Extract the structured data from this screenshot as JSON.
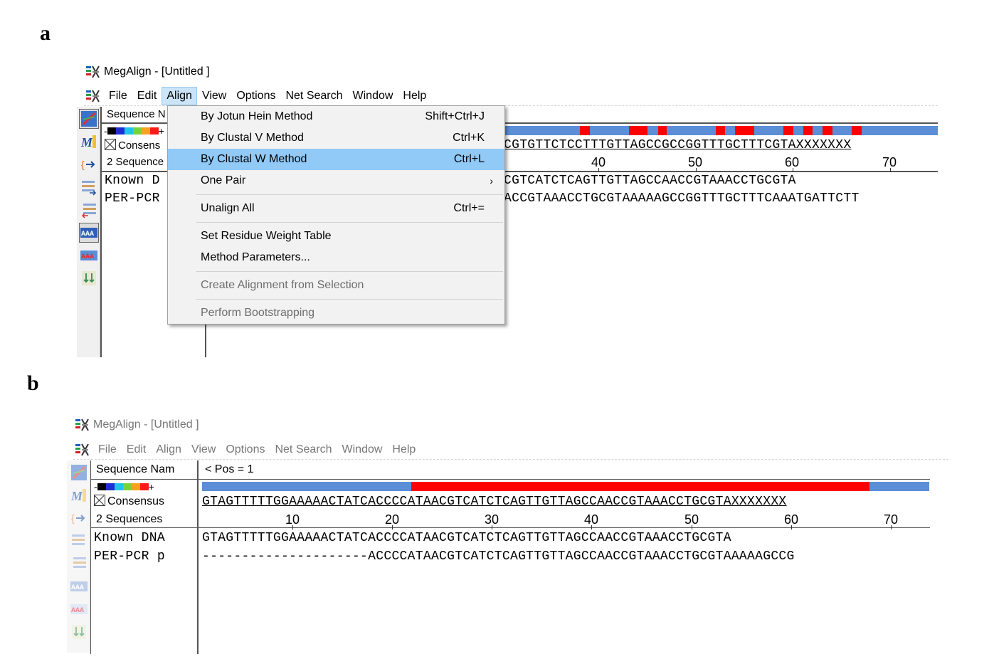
{
  "panels": {
    "a": {
      "letter": "a",
      "window_title": "MegAlign - [Untitled ]",
      "menu": [
        "File",
        "Edit",
        "Align",
        "View",
        "Options",
        "Net Search",
        "Window",
        "Help"
      ],
      "active_menu": "Align",
      "names_header": "Sequence N",
      "consensus_label": "Consens",
      "sequences_label": "2 Sequence",
      "seq_names": [
        "Known D",
        "PER-PCR"
      ],
      "consensus_seq": "CGTGTTCTCCTTTGTTAGCCGCCGGTTTGCTTTCGTAXXXXXXX",
      "seq_rows": [
        "CGTCATCTCAGTTGTTAGCCAACCGTAAACCTGCGTA",
        "ACCGTAAACCTGCGTAAAAAGCCGGTTTGCTTTCAAATGATTCTT"
      ],
      "ruler": [
        "40",
        "50",
        "60",
        "70"
      ],
      "dropdown": {
        "items": [
          {
            "label": "By Jotun Hein Method",
            "shortcut": "Shift+Ctrl+J"
          },
          {
            "label": "By Clustal V Method",
            "shortcut": "Ctrl+K"
          },
          {
            "label": "By Clustal W Method",
            "shortcut": "Ctrl+L",
            "highlighted": true
          },
          {
            "label": "One Pair",
            "submenu_arrow": "›"
          },
          {
            "label": "Unalign All",
            "shortcut": "Ctrl+="
          },
          {
            "label": "Set Residue Weight Table"
          },
          {
            "label": "Method Parameters..."
          },
          {
            "label": "Create Alignment from Selection",
            "disabled": true
          },
          {
            "label": "Perform Bootstrapping",
            "disabled": true
          }
        ]
      }
    },
    "b": {
      "letter": "b",
      "window_title": "MegAlign - [Untitled ]",
      "menu": [
        "File",
        "Edit",
        "Align",
        "View",
        "Options",
        "Net Search",
        "Window",
        "Help"
      ],
      "names_header": "Sequence Nam",
      "pos_label": "< Pos = 1",
      "consensus_label": "Consensus",
      "sequences_label": "2 Sequences",
      "seq_names": [
        "Known DNA",
        "PER-PCR p"
      ],
      "consensus_seq": "GTAGTTTTTGGAAAAACTATCACCCCATAACGTCATCTCAGTTGTTAGCCAACCGTAAACCTGCGTAXXXXXXX",
      "seq_rows": [
        "GTAGTTTTTGGAAAAACTATCACCCCATAACGTCATCTCAGTTGTTAGCCAACCGTAAACCTGCGTA",
        "---------------------ACCCCATAACGTCATCTCAGTTGTTAGCCAACCGTAAACCTGCGTAAAAAGCCG"
      ],
      "ruler": [
        "10",
        "20",
        "30",
        "40",
        "50",
        "60",
        "70"
      ]
    }
  },
  "colors": {
    "consensus_blue": "#5b8ed6",
    "consensus_red": "#ff0000",
    "menu_highlight": "#91c9f7"
  },
  "icons": [
    "megalign-app-icon",
    "dna-helix-icon",
    "align-script-icon",
    "arrow-tool-icon",
    "list-right-icon",
    "list-left-icon",
    "aaa-bold-icon",
    "aaa-color-icon",
    "sort-arrows-icon"
  ]
}
